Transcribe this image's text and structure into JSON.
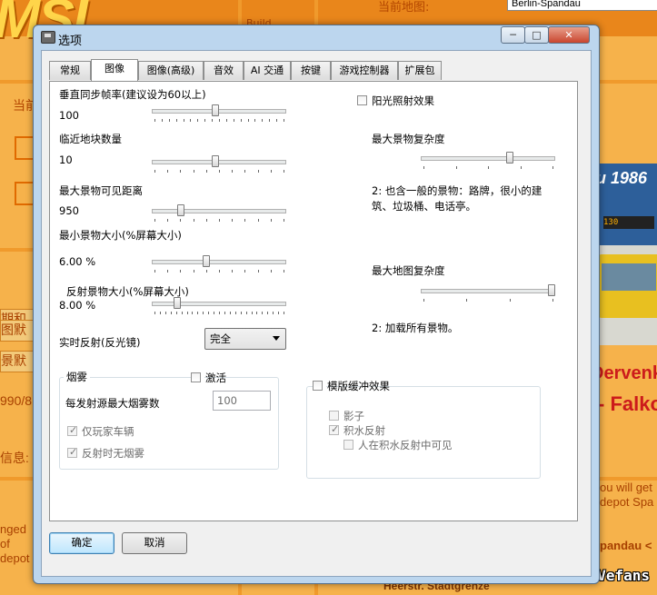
{
  "background": {
    "logo": "MSI",
    "map_label": "当前地图:",
    "map_value": "Berlin-Spandau",
    "left_fragments": [
      "当前",
      "期和",
      "图默",
      "景默",
      "990/8",
      "信息:"
    ],
    "snippets": [
      "Build",
      "u 1986",
      "130",
      "Dervenk",
      "- Falko",
      "ou will get",
      "depot Spa",
      "pandau <",
      "nged",
      "of",
      "depot"
    ],
    "bottom_text": "Heerstr. Stadtgrenze",
    "watermark": "@Vefans"
  },
  "window": {
    "title": "选项",
    "controls": {
      "minimize": "─",
      "maximize": "□",
      "close": "✕"
    }
  },
  "tabs": [
    {
      "label": "常规",
      "active": false
    },
    {
      "label": "图像",
      "active": true
    },
    {
      "label": "图像(高级)",
      "active": false
    },
    {
      "label": "音效",
      "active": false
    },
    {
      "label": "AI 交通",
      "active": false
    },
    {
      "label": "按键",
      "active": false
    },
    {
      "label": "游戏控制器",
      "active": false
    },
    {
      "label": "扩展包",
      "active": false
    }
  ],
  "graphics": {
    "vsync": {
      "label": "垂直同步帧率(建议设为60以上)",
      "value": "100",
      "level": 0.47
    },
    "tiles": {
      "label": "临近地块数量",
      "value": "10",
      "level": 0.47
    },
    "obj_distance": {
      "label": "最大景物可见距离",
      "value": "950",
      "level": 0.2
    },
    "min_obj_size": {
      "label": "最小景物大小(%屏幕大小)",
      "value": "6.00 %",
      "level": 0.4
    },
    "reflect_obj_size": {
      "label": "反射景物大小(%屏幕大小)",
      "value": "8.00 %",
      "level": 0.17
    },
    "realtime_reflection": {
      "label": "实时反射(反光镜)",
      "selected": "完全"
    },
    "sun_glare": {
      "label": "阳光照射效果",
      "checked": false
    },
    "obj_complexity": {
      "label": "最大景物复杂度",
      "level": 0.67,
      "desc": "2: 也含一般的景物：路牌，很小的建筑、垃圾桶、电话亭。"
    },
    "map_complexity": {
      "label": "最大地图复杂度",
      "level": 1.0,
      "desc": "2: 加载所有景物。"
    },
    "fog": {
      "title": "烟雾",
      "activate_label": "激活",
      "activate_checked": false,
      "max_smoke_label": "每发射源最大烟雾数",
      "max_smoke_value": "100",
      "only_player_label": "仅玩家车辆",
      "only_player_checked": true,
      "no_smoke_reflect_label": "反射时无烟雾",
      "no_smoke_reflect_checked": true
    },
    "stencil": {
      "title": "模版缓冲效果",
      "checked": false,
      "shadow_label": "影子",
      "shadow_checked": false,
      "water_label": "积水反射",
      "water_checked": true,
      "people_label": "人在积水反射中可见",
      "people_checked": false
    }
  },
  "buttons": {
    "ok": "确定",
    "cancel": "取消"
  }
}
